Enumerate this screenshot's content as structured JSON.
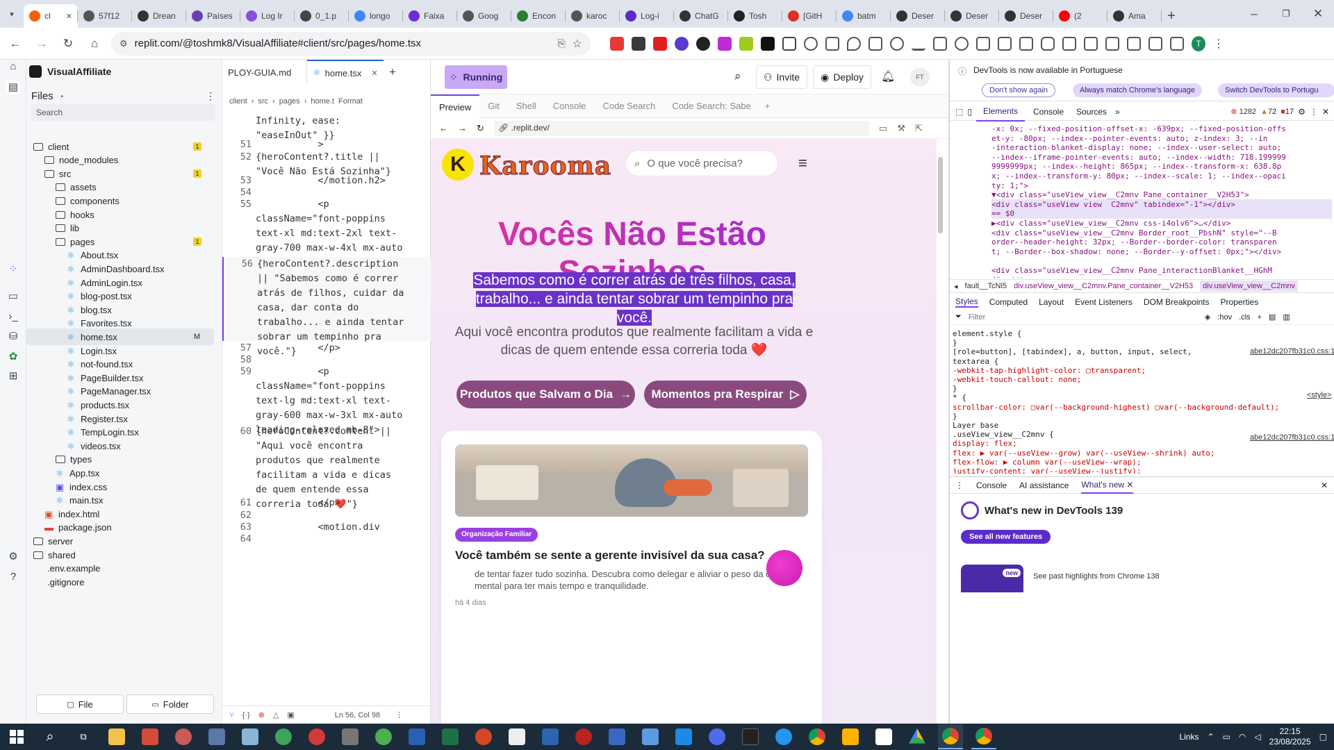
{
  "browser": {
    "tabs": [
      {
        "label": "cl",
        "color": "#f26207",
        "active": true
      },
      {
        "label": "57f12",
        "color": "#555"
      },
      {
        "label": "Drean",
        "color": "#333"
      },
      {
        "label": "Países",
        "color": "#6a3fb5"
      },
      {
        "label": "Log Ir",
        "color": "#8a4fd8"
      },
      {
        "label": "0_1.p",
        "color": "#444"
      },
      {
        "label": "longo",
        "color": "#4285f4"
      },
      {
        "label": "Faixa",
        "color": "#6c2bd9"
      },
      {
        "label": "Goog",
        "color": "#555"
      },
      {
        "label": "Encon",
        "color": "#2e7d32"
      },
      {
        "label": "karoc",
        "color": "#555"
      },
      {
        "label": "Log-i",
        "color": "#5b2cc9"
      },
      {
        "label": "ChatG",
        "color": "#333"
      },
      {
        "label": "Tosh",
        "color": "#222"
      },
      {
        "label": "[GitH",
        "color": "#d93025"
      },
      {
        "label": "batm",
        "color": "#4285f4"
      },
      {
        "label": "Deser",
        "color": "#333"
      },
      {
        "label": "Deser",
        "color": "#333"
      },
      {
        "label": "Deser",
        "color": "#333"
      },
      {
        "label": "(2",
        "color": "#ff0000"
      },
      {
        "label": "Ama",
        "color": "#333"
      }
    ],
    "url": "replit.com/@toshmk8/VisualAffiliate#client/src/pages/home.tsx"
  },
  "replit": {
    "app_name": "VisualAffiliate",
    "run_status": "Running",
    "invite_label": "Invite",
    "deploy_label": "Deploy",
    "avatar_initials": "FT",
    "files_title": "Files",
    "search_placeholder": "Search",
    "file_button": "File",
    "folder_button": "Folder",
    "tree": [
      {
        "name": "client",
        "type": "folder",
        "indent": 0,
        "badge": "1"
      },
      {
        "name": "node_modules",
        "type": "folder",
        "indent": 1
      },
      {
        "name": "src",
        "type": "folder",
        "indent": 1,
        "badge": "1"
      },
      {
        "name": "assets",
        "type": "folder",
        "indent": 2
      },
      {
        "name": "components",
        "type": "folder",
        "indent": 2
      },
      {
        "name": "hooks",
        "type": "folder",
        "indent": 2
      },
      {
        "name": "lib",
        "type": "folder",
        "indent": 2
      },
      {
        "name": "pages",
        "type": "folder",
        "indent": 2,
        "badge": "1"
      },
      {
        "name": "About.tsx",
        "type": "react",
        "indent": 3
      },
      {
        "name": "AdminDashboard.tsx",
        "type": "react",
        "indent": 3
      },
      {
        "name": "AdminLogin.tsx",
        "type": "react",
        "indent": 3
      },
      {
        "name": "blog-post.tsx",
        "type": "react",
        "indent": 3
      },
      {
        "name": "blog.tsx",
        "type": "react",
        "indent": 3
      },
      {
        "name": "Favorites.tsx",
        "type": "react",
        "indent": 3
      },
      {
        "name": "home.tsx",
        "type": "react",
        "indent": 3,
        "mark": "M",
        "selected": true
      },
      {
        "name": "Login.tsx",
        "type": "react",
        "indent": 3
      },
      {
        "name": "not-found.tsx",
        "type": "react",
        "indent": 3
      },
      {
        "name": "PageBuilder.tsx",
        "type": "react",
        "indent": 3
      },
      {
        "name": "PageManager.tsx",
        "type": "react",
        "indent": 3
      },
      {
        "name": "products.tsx",
        "type": "react",
        "indent": 3
      },
      {
        "name": "Register.tsx",
        "type": "react",
        "indent": 3
      },
      {
        "name": "TempLogin.tsx",
        "type": "react",
        "indent": 3
      },
      {
        "name": "videos.tsx",
        "type": "react",
        "indent": 3
      },
      {
        "name": "types",
        "type": "folder",
        "indent": 2
      },
      {
        "name": "App.tsx",
        "type": "react",
        "indent": 2
      },
      {
        "name": "index.css",
        "type": "css",
        "indent": 2
      },
      {
        "name": "main.tsx",
        "type": "react",
        "indent": 2
      },
      {
        "name": "index.html",
        "type": "html",
        "indent": 1
      },
      {
        "name": "package.json",
        "type": "json",
        "indent": 1
      },
      {
        "name": "server",
        "type": "folder",
        "indent": 0
      },
      {
        "name": "shared",
        "type": "folder",
        "indent": 0
      },
      {
        "name": ".env.example",
        "type": "file",
        "indent": 0
      },
      {
        "name": ".gitignore",
        "type": "file",
        "indent": 0
      }
    ],
    "editor": {
      "tab_inactive": "PLOY-GUIA.md",
      "tab_active": "home.tsx",
      "breadcrumb": [
        "client",
        "src",
        "pages",
        "home.t",
        "Format"
      ],
      "status": "Ln 56, Col 98",
      "lines": [
        {
          "n": "",
          "t": "Infinity, ease:\n\"easeInOut\" }}"
        },
        {
          "n": "51",
          "t": "           >"
        },
        {
          "n": "52",
          "t": "{heroContent?.title ||\n\"Você Não Está Sozinha\"}"
        },
        {
          "n": "53",
          "t": "           </motion.h2>"
        },
        {
          "n": "54",
          "t": ""
        },
        {
          "n": "55",
          "t": "           <p\nclassName=\"font-poppins\ntext-xl md:text-2xl text-\ngray-700 max-w-4xl mx-auto\nleading-relaxed mb-6\">"
        },
        {
          "n": "56",
          "t": "{heroContent?.description\n|| \"Sabemos como é correr\natrás de filhos, cuidar da\ncasa, dar conta do\ntrabalho... e ainda tentar\nsobrar um tempinho pra\nvocê.\"}"
        },
        {
          "n": "57",
          "t": "           </p>"
        },
        {
          "n": "58",
          "t": ""
        },
        {
          "n": "59",
          "t": "           <p\nclassName=\"font-poppins\ntext-lg md:text-xl text-\ngray-600 max-w-3xl mx-auto\nleading-relaxed mb-8\">"
        },
        {
          "n": "60",
          "t": "{heroContent?.content ||\n\"Aqui você encontra\nprodutos que realmente\nfacilitam a vida e dicas\nde quem entende essa\ncorreria toda ❤️\"}"
        },
        {
          "n": "61",
          "t": "           </p>"
        },
        {
          "n": "62",
          "t": ""
        },
        {
          "n": "63",
          "t": "           <motion.div"
        },
        {
          "n": "64",
          "t": ""
        }
      ]
    },
    "preview": {
      "tabs": [
        "Preview",
        "Git",
        "Shell",
        "Console",
        "Code Search",
        "Code Search: Sabe"
      ],
      "url": ".replit.dev/",
      "site": {
        "logo": "Karooma",
        "search_placeholder": "O que você precisa?",
        "hero_title": "Vocês Não Estão Sozinhos",
        "hero_description": "Sabemos como é correr atrás de três filhos, casa, trabalho... e ainda tentar sobrar um tempinho pra você.",
        "hero_content": "Aqui você encontra produtos que realmente facilitam a vida e dicas de quem entende essa correria toda ❤️",
        "btn_products": "Produtos que Salvam o Dia",
        "btn_moments": "Momentos pra Respirar",
        "card": {
          "tag": "Organização Familiar",
          "title": "Você também se sente a gerente invisível da sua casa?",
          "excerpt": "de tentar fazer tudo sozinha. Descubra como delegar e aliviar o peso da carga mental para ter mais tempo e tranquilidade.",
          "meta": "há 4 dias"
        }
      }
    }
  },
  "devtools": {
    "banner": "DevTools is now available in Portuguese",
    "banner_btn1": "Don't show again",
    "banner_btn2": "Always match Chrome's language",
    "banner_btn3": "Switch DevTools to Portugu",
    "tabs": [
      "Elements",
      "Console",
      "Sources"
    ],
    "errors": "1282",
    "warnings": "72",
    "issues": "17",
    "dom_lines": [
      "-x: 0x; --fixed-position-offset-x: -639px; --fixed-position-offs",
      "et-y: -80px; --index--pointer-events: auto; z-index: 3; --in",
      "-interaction-blanket-display: none; --index--user-select: auto;",
      " --index--iframe-pointer-events: auto; --index--width: 718.199999",
      "9999999px; --index--height: 865px; --index--transform-x: 638.8p",
      "x; --index--transform-y: 80px; --index--scale: 1; --index--opaci",
      "ty: 1;\">",
      "▼<div class=\"useView_view__C2mnv Pane_container__V2H53\">",
      "  <div class=\"useView_view__C2mnv\" tabindex=\"-1\"></div>",
      "   == $0",
      " ▶<div class=\"useView_view__C2mnv css-i4olv6\">…</div>",
      "<div class=\"useView_view__C2mnv Border_root__PbshN\" style=\"--B",
      "order--header-height: 32px; --Border--border-color: transparen",
      "t; --Border--box-shadow: none; --Border--y-offset: 0px;\"></div>",
      "",
      "<div class=\"useView_view__C2mnv Pane_interactionBlanket__HGhM",
      "4\"></div>"
    ],
    "crumbs": [
      "fault__TcNl5",
      "div.useView_view__C2mnv.Pane_container__V2H53",
      "div.useView_view__C2mnv"
    ],
    "style_tabs": [
      "Styles",
      "Computed",
      "Layout",
      "Event Listeners",
      "DOM Breakpoints",
      "Properties"
    ],
    "filter_placeholder": "Filter",
    "hov": ":hov",
    "cls": ".cls",
    "css_lines": [
      "element.style {",
      "}",
      "[role=button], [tabindex], a, button, input, select,",
      "textarea {",
      "  -webkit-tap-highlight-color: ▢transparent;",
      "  -webkit-touch-callout: none;",
      "}",
      "* {",
      "  scrollbar-color: ▢var(--background-highest) ▢var(--background-default);",
      "}",
      "Layer base",
      ".useView_view__C2mnv {",
      "  display: flex;",
      "  flex: ▶ var(--useView--grow) var(--useView--shrink) auto;",
      "  flex-flow: ▶ column var(--useView--wrap);",
      "  justify-content: var(--useView--justify);"
    ],
    "css_src1": "abe12dc207fb31c0.css:1",
    "css_src2": "<style>",
    "css_src3": "abe12dc207fb31c0.css:1",
    "drawer_tabs": [
      "Console",
      "AI assistance",
      "What's new"
    ],
    "whats_new_title": "What's new in DevTools 139",
    "see_all": "See all new features",
    "past_highlights": "See past highlights from Chrome 138",
    "new_badge": "new"
  },
  "taskbar": {
    "links_label": "Links",
    "time": "22:15",
    "date": "23/08/2025"
  },
  "colors": {
    "replit_running_bg": "#c9a8f5",
    "hero_title_gradient_start": "#e0359a",
    "hero_title_gradient_end": "#9b2bd6",
    "highlight": "#6a32c9",
    "button_bg": "#8a4a7e",
    "tag_bg": "#9b3fe0"
  }
}
